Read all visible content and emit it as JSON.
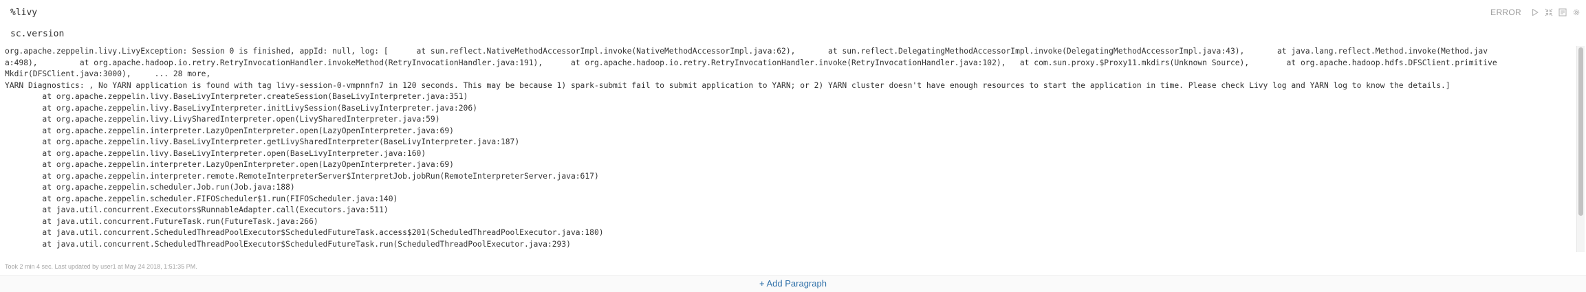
{
  "paragraph": {
    "code_lines": [
      "%livy",
      "sc.version"
    ],
    "status": "ERROR",
    "controls": [
      {
        "name": "run-icon",
        "label": "Run this paragraph"
      },
      {
        "name": "hide-editor-icon",
        "label": "Hide editor"
      },
      {
        "name": "output-toggle-icon",
        "label": "Hide output"
      },
      {
        "name": "settings-icon",
        "label": "Settings"
      }
    ],
    "output_lines": [
      "org.apache.zeppelin.livy.LivyException: Session 0 is finished, appId: null, log: [      at sun.reflect.NativeMethodAccessorImpl.invoke(NativeMethodAccessorImpl.java:62),       at sun.reflect.DelegatingMethodAccessorImpl.invoke(DelegatingMethodAccessorImpl.java:43),       at java.lang.reflect.Method.invoke(Method.jav",
      "a:498),         at org.apache.hadoop.io.retry.RetryInvocationHandler.invokeMethod(RetryInvocationHandler.java:191),      at org.apache.hadoop.io.retry.RetryInvocationHandler.invoke(RetryInvocationHandler.java:102),   at com.sun.proxy.$Proxy11.mkdirs(Unknown Source),        at org.apache.hadoop.hdfs.DFSClient.primitive",
      "Mkdir(DFSClient.java:3000),     ... 28 more,",
      "YARN Diagnostics: , No YARN application is found with tag livy-session-0-vmpnnfn7 in 120 seconds. This may be because 1) spark-submit fail to submit application to YARN; or 2) YARN cluster doesn't have enough resources to start the application in time. Please check Livy log and YARN log to know the details.]",
      "\tat org.apache.zeppelin.livy.BaseLivyInterpreter.createSession(BaseLivyInterpreter.java:351)",
      "\tat org.apache.zeppelin.livy.BaseLivyInterpreter.initLivySession(BaseLivyInterpreter.java:206)",
      "\tat org.apache.zeppelin.livy.LivySharedInterpreter.open(LivySharedInterpreter.java:59)",
      "\tat org.apache.zeppelin.interpreter.LazyOpenInterpreter.open(LazyOpenInterpreter.java:69)",
      "\tat org.apache.zeppelin.livy.BaseLivyInterpreter.getLivySharedInterpreter(BaseLivyInterpreter.java:187)",
      "\tat org.apache.zeppelin.livy.BaseLivyInterpreter.open(BaseLivyInterpreter.java:160)",
      "\tat org.apache.zeppelin.interpreter.LazyOpenInterpreter.open(LazyOpenInterpreter.java:69)",
      "\tat org.apache.zeppelin.interpreter.remote.RemoteInterpreterServer$InterpretJob.jobRun(RemoteInterpreterServer.java:617)",
      "\tat org.apache.zeppelin.scheduler.Job.run(Job.java:188)",
      "\tat org.apache.zeppelin.scheduler.FIFOScheduler$1.run(FIFOScheduler.java:140)",
      "\tat java.util.concurrent.Executors$RunnableAdapter.call(Executors.java:511)",
      "\tat java.util.concurrent.FutureTask.run(FutureTask.java:266)",
      "\tat java.util.concurrent.ScheduledThreadPoolExecutor$ScheduledFutureTask.access$201(ScheduledThreadPoolExecutor.java:180)",
      "\tat java.util.concurrent.ScheduledThreadPoolExecutor$ScheduledFutureTask.run(ScheduledThreadPoolExecutor.java:293)"
    ],
    "footer": "Took 2 min 4 sec. Last updated by user1 at May 24 2018, 1:51:35 PM."
  },
  "add_paragraph_label": "+ Add Paragraph",
  "colors": {
    "status_error": "#9a9a9a",
    "link": "#3071a9",
    "text": "#333333"
  }
}
